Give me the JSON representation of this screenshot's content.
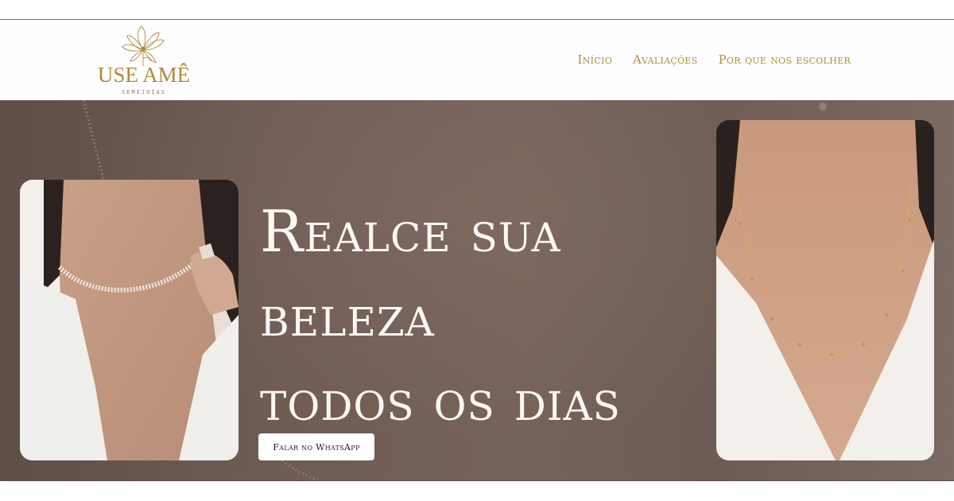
{
  "brand": {
    "name": "USE AMÊ",
    "tagline": "SEMIJOIAS",
    "accent_color": "#b08a3e",
    "logo_icon": "flower-icon"
  },
  "nav": {
    "items": [
      {
        "label": "Início"
      },
      {
        "label": "Avaliações"
      },
      {
        "label": "Por que nos escolher"
      }
    ]
  },
  "hero": {
    "headline": {
      "line1": "Realce sua",
      "line2": "beleza",
      "line3": "todos os dias"
    },
    "cta_label": "Falar no WhatsApp",
    "background_color": "#6f5c55",
    "left_photo": "woman-wearing-crystal-choker-photo",
    "right_photo": "woman-wearing-gold-beaded-necklace-photo"
  }
}
